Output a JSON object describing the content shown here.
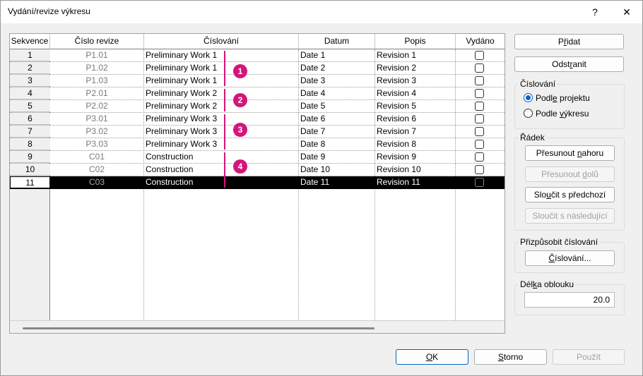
{
  "window": {
    "title": "Vydání/revize výkresu",
    "help_glyph": "?",
    "close_glyph": "✕"
  },
  "table": {
    "headers": [
      "Sekvence",
      "Číslo revize",
      "Číslování",
      "Datum",
      "Popis",
      "Vydáno"
    ],
    "rows": [
      {
        "seq": "1",
        "rev": "P1.01",
        "num": "Preliminary Work 1",
        "date": "Date 1",
        "desc": "Revision 1"
      },
      {
        "seq": "2",
        "rev": "P1.02",
        "num": "Preliminary Work 1",
        "date": "Date 2",
        "desc": "Revision 2"
      },
      {
        "seq": "3",
        "rev": "P1.03",
        "num": "Preliminary Work 1",
        "date": "Date 3",
        "desc": "Revision 3"
      },
      {
        "seq": "4",
        "rev": "P2.01",
        "num": "Preliminary Work 2",
        "date": "Date 4",
        "desc": "Revision 4"
      },
      {
        "seq": "5",
        "rev": "P2.02",
        "num": "Preliminary Work 2",
        "date": "Date 5",
        "desc": "Revision 5"
      },
      {
        "seq": "6",
        "rev": "P3.01",
        "num": "Preliminary Work 3",
        "date": "Date 6",
        "desc": "Revision 6"
      },
      {
        "seq": "7",
        "rev": "P3.02",
        "num": "Preliminary Work 3",
        "date": "Date 7",
        "desc": "Revision 7"
      },
      {
        "seq": "8",
        "rev": "P3.03",
        "num": "Preliminary Work 3",
        "date": "Date 8",
        "desc": "Revision 8"
      },
      {
        "seq": "9",
        "rev": "C01",
        "num": "Construction",
        "date": "Date 9",
        "desc": "Revision 9"
      },
      {
        "seq": "10",
        "rev": "C02",
        "num": "Construction",
        "date": "Date 10",
        "desc": "Revision 10"
      },
      {
        "seq": "11",
        "rev": "C03",
        "num": "Construction",
        "date": "Date 11",
        "desc": "Revision 11"
      }
    ],
    "selected_row": "11"
  },
  "callouts": [
    "1",
    "2",
    "3",
    "4"
  ],
  "accent_color": "#d4157a",
  "side": {
    "add_pre": "P",
    "add_key": "ř",
    "add_post": "idat",
    "remove_pre": "Odst",
    "remove_key": "r",
    "remove_post": "anit",
    "numbering_group": "Číslování",
    "radio_project_pre": "Podl",
    "radio_project_key": "e",
    "radio_project_post": " projektu",
    "radio_sheet_pre": "Podle ",
    "radio_sheet_key": "v",
    "radio_sheet_post": "ýkresu",
    "row_group": "Řádek",
    "move_up_pre": "Přesunout ",
    "move_up_key": "n",
    "move_up_post": "ahoru",
    "move_down_pre": "Přesunout ",
    "move_down_key": "d",
    "move_down_post": "olů",
    "merge_prev_pre": "Slo",
    "merge_prev_key": "u",
    "merge_prev_post": "čit s předchozí",
    "merge_next": "Sloučit s následující",
    "customize_group": "Přizpůsobit číslování",
    "numbering_btn_pre": "",
    "numbering_btn_key": "Č",
    "numbering_btn_post": "íslování...",
    "arc_group_pre": "Dél",
    "arc_group_key": "k",
    "arc_group_post": "a oblouku",
    "arc_value": "20.0"
  },
  "footer": {
    "ok_pre": "",
    "ok_key": "O",
    "ok_post": "K",
    "cancel_pre": "",
    "cancel_key": "S",
    "cancel_post": "torno",
    "apply_pre": "Použít"
  }
}
